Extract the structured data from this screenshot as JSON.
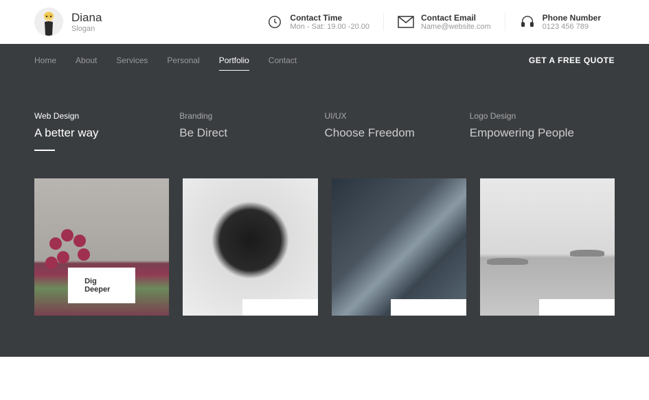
{
  "brand": {
    "name": "Diana",
    "slogan": "Slogan"
  },
  "contacts": [
    {
      "label": "Contact Time",
      "value": "Mon - Sat: 19.00 -20.00",
      "icon": "clock-icon"
    },
    {
      "label": "Contact Email",
      "value": "Name@website.com",
      "icon": "mail-icon"
    },
    {
      "label": "Phone Number",
      "value": "0123 456 789",
      "icon": "headset-icon"
    }
  ],
  "nav": {
    "items": [
      "Home",
      "About",
      "Services",
      "Personal",
      "Portfolio",
      "Contact"
    ],
    "active_index": 4,
    "cta": "GET A FREE QUOTE"
  },
  "portfolio": {
    "tabs": [
      {
        "category": "Web Design",
        "title": "A better way"
      },
      {
        "category": "Branding",
        "title": "Be Direct"
      },
      {
        "category": "UI/UX",
        "title": "Choose Freedom"
      },
      {
        "category": "Logo Design",
        "title": "Empowering People"
      }
    ],
    "active_tab_index": 0,
    "cards": [
      {
        "label": "Dig Deeper"
      },
      {
        "label": ""
      },
      {
        "label": ""
      },
      {
        "label": ""
      }
    ]
  }
}
